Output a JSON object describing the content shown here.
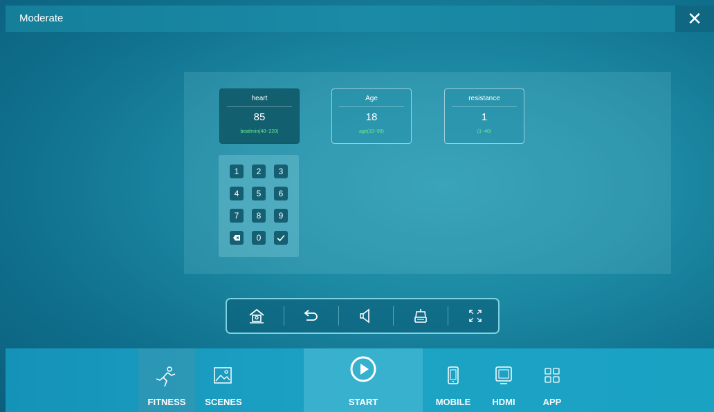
{
  "window": {
    "title": "Moderate",
    "close_icon": "close-icon"
  },
  "params": [
    {
      "name": "heart",
      "value": "85",
      "range": "beat/min(40~220)",
      "selected": true
    },
    {
      "name": "Age",
      "value": "18",
      "range": "age(10~99)",
      "selected": false
    },
    {
      "name": "resistance",
      "value": "1",
      "range": "(1~40)",
      "selected": false
    }
  ],
  "keypad": {
    "keys": [
      "1",
      "2",
      "3",
      "4",
      "5",
      "6",
      "7",
      "8",
      "9",
      "0"
    ],
    "backspace_icon": "backspace-icon",
    "confirm_icon": "checkmark-icon"
  },
  "toolbar": {
    "icons": [
      "home-icon",
      "back-icon",
      "volume-icon",
      "treadmill-icon",
      "fullscreen-icon"
    ]
  },
  "nav": {
    "fitness": "FITNESS",
    "scenes": "SCENES",
    "start": "START",
    "mobile": "MOBILE",
    "hdmi": "HDMI",
    "app": "APP"
  },
  "colors": {
    "range_text": "#6bf08c",
    "selected_box": "#125f70",
    "close_bg": "#0f6781"
  }
}
